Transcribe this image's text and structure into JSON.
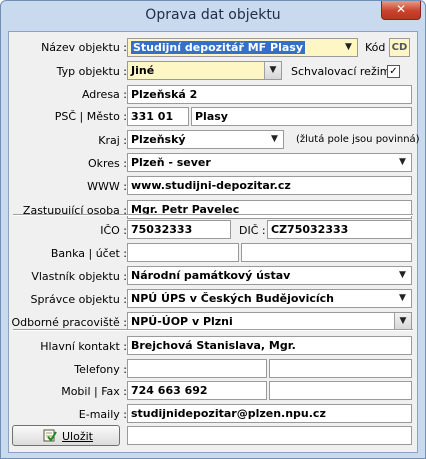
{
  "window": {
    "title": "Oprava dat objektu",
    "close_glyph": "✕"
  },
  "form": {
    "nazev": {
      "label": "Název objektu :",
      "value": "Studijní depozitář MF Plasy"
    },
    "kod": {
      "label": "Kód",
      "value": "CD"
    },
    "typ": {
      "label": "Typ objektu :",
      "value": "Jiné"
    },
    "schvalovaci": {
      "label": "Schvalovací režim :",
      "checked": "✓"
    },
    "adresa": {
      "label": "Adresa :",
      "value": "Plzeňská 2"
    },
    "psc_mesto": {
      "label": "PSČ | Město :",
      "psc": "331 01",
      "mesto": "Plasy"
    },
    "kraj": {
      "label": "Kraj :",
      "value": "Plzeňský"
    },
    "note": "(žlutá pole jsou povinná)",
    "okres": {
      "label": "Okres :",
      "value": "Plzeň - sever"
    },
    "www": {
      "label": "WWW :",
      "value": "www.studijni-depozitar.cz"
    },
    "zastupujici": {
      "label": "Zastupující osoba :",
      "value": "Mgr. Petr Pavelec"
    },
    "ico": {
      "label": "IČO :",
      "value": "75032333"
    },
    "dic": {
      "label": "DIČ :",
      "value": "CZ75032333"
    },
    "banka": {
      "label": "Banka | účet :",
      "value1": "",
      "value2": ""
    },
    "vlastnik": {
      "label": "Vlastník objektu :",
      "value": "Národní památkový ústav"
    },
    "spravce": {
      "label": "Správce objektu :",
      "value": "NPÚ ÚPS v Českých Budějovicích"
    },
    "odborne": {
      "label": "Odborné pracoviště :",
      "value": "NPÚ-ÚOP v Plzni"
    },
    "hlavni": {
      "label": "Hlavní kontakt :",
      "value": "Brejchová Stanislava, Mgr."
    },
    "telefony": {
      "label": "Telefony :",
      "value1": "",
      "value2": ""
    },
    "mobil_fax": {
      "label": "Mobil | Fax :",
      "mobil": "724 663 692",
      "fax": ""
    },
    "emaily": {
      "label": "E-maily :",
      "value": "studijnidepozitar@plzen.npu.cz"
    },
    "status": ""
  },
  "buttons": {
    "save": "Uložit"
  },
  "icons": {
    "save": "notepad-check-icon",
    "dropdown": "chevron-down-icon",
    "close": "close-icon"
  },
  "colors": {
    "required": "#fff6c6",
    "selection": "#3470c9",
    "close": "#c9432c"
  }
}
